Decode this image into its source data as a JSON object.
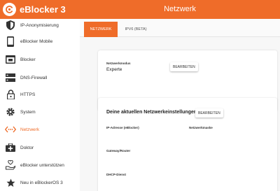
{
  "header": {
    "app_title": "eBlocker 3",
    "page_title": "Netzwerk",
    "accent_color": "#ef6c29"
  },
  "sidebar": {
    "items": [
      {
        "label": "IP-Anonymisierung",
        "icon": "shield-icon",
        "active": false
      },
      {
        "label": "eBlocker Mobile",
        "icon": "phone-icon",
        "active": false
      },
      {
        "label": "Blocker",
        "icon": "blocker-icon",
        "active": false
      },
      {
        "label": "DNS-Firewall",
        "icon": "server-icon",
        "active": false
      },
      {
        "label": "HTTPS",
        "icon": "lock-icon",
        "active": false
      },
      {
        "label": "System",
        "icon": "gear-icon",
        "active": false
      },
      {
        "label": "Netzwerk",
        "icon": "network-icon",
        "active": true
      },
      {
        "label": "Doktor",
        "icon": "medkit-icon",
        "active": false
      },
      {
        "label": "eBlocker unterstützen",
        "icon": "support-icon",
        "active": false
      },
      {
        "label": "Neu in eBlockerOS 3",
        "icon": "star-icon",
        "active": false
      }
    ]
  },
  "tabs": [
    {
      "label": "NETZWERK",
      "active": true
    },
    {
      "label": "IPV6 (BETA)",
      "active": false
    }
  ],
  "mode_card": {
    "label": "Netzwerkmodus",
    "value": "Experte",
    "button": "BEARBEITEN"
  },
  "settings_card": {
    "heading": "Deine aktuellen Netzwerkeinstellungen:",
    "button": "BEARBEITEN",
    "fields": {
      "ip_address": "IP-Adresse (eBlocker)",
      "netmask": "Netzwerkmaske",
      "gateway": "Gateway/Router",
      "dhcp": "DHCP-Dienst"
    }
  }
}
